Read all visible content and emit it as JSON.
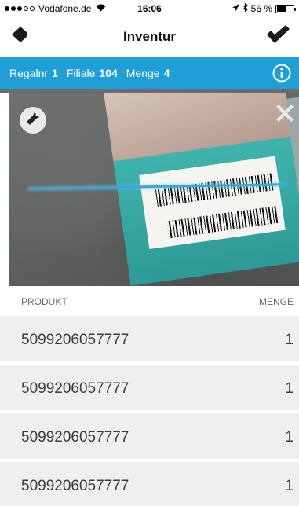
{
  "status_bar": {
    "carrier": "Vodafone.de",
    "time": "16:06",
    "battery_text": "56 %",
    "battery_level": 0.56
  },
  "nav": {
    "title": "Inventur",
    "back_icon": "back-arrow-icon",
    "confirm_icon": "checkmark-icon"
  },
  "info_bar": {
    "regalnr_label": "Regalnr",
    "regalnr_value": "1",
    "filiale_label": "Filiale",
    "filiale_value": "104",
    "menge_label": "Menge",
    "menge_value": "4",
    "info_icon": "info-icon"
  },
  "camera": {
    "flash_icon": "flashlight-icon",
    "close_icon": "close-icon"
  },
  "list": {
    "header_product": "PRODUKT",
    "header_quantity": "MENGE",
    "rows": [
      {
        "code": "5099206057777",
        "qty": "1"
      },
      {
        "code": "5099206057777",
        "qty": "1"
      },
      {
        "code": "5099206057777",
        "qty": "1"
      },
      {
        "code": "5099206057777",
        "qty": "1"
      }
    ]
  },
  "colors": {
    "accent": "#1f9ed8",
    "row_background": "#efefef"
  }
}
